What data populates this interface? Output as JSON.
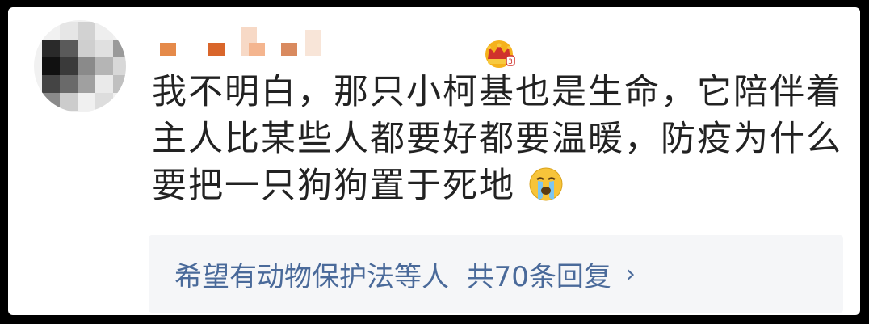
{
  "comment": {
    "line1": "我不明白，那只小柯基也是生命，它陪伴着",
    "line2": "主人比某些人都要好都要温暖，防疫为什么",
    "line3": "要把一只狗狗置于死地",
    "emoji": "crying-face"
  },
  "user": {
    "badge_icon": "crown-badge-icon",
    "name_obscured": true
  },
  "replies": {
    "preview": "希望有动物保护法等人",
    "count_text": "共70条回复",
    "chevron": "›"
  },
  "colors": {
    "link": "#4a6a9a",
    "reply_bg": "#f5f6f8",
    "text": "#222222",
    "frame": "#000000"
  }
}
